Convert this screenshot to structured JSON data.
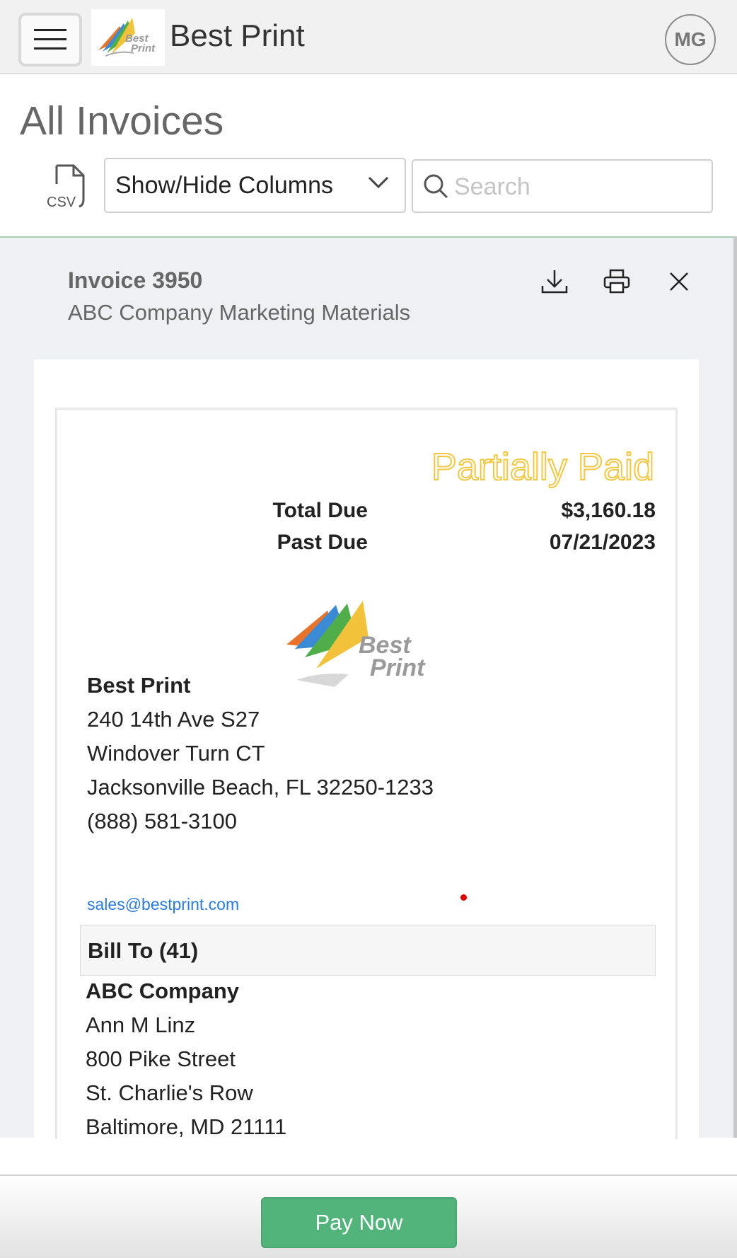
{
  "header": {
    "app_title": "Best Print",
    "avatar_initials": "MG",
    "icons": {
      "menu": "hamburger-menu-icon",
      "logo": "best-print-logo"
    }
  },
  "page": {
    "title": "All Invoices"
  },
  "toolbar": {
    "csv_label": "CSV",
    "columns_select": "Show/Hide Columns",
    "search_placeholder": "Search",
    "search_value": ""
  },
  "invoice": {
    "number": "Invoice 3950",
    "description": "ABC Company Marketing Materials",
    "actions": [
      "download-icon",
      "print-icon",
      "close-icon"
    ],
    "status": "Partially Paid",
    "status_color": "#f2c744",
    "total_due_label": "Total Due",
    "total_due_value": "$3,160.18",
    "past_due_label": "Past Due",
    "past_due_value": "07/21/2023",
    "logo_text_line1": "Best",
    "logo_text_line2": "Print"
  },
  "seller": {
    "name": "Best Print",
    "address1": "240 14th Ave S27",
    "address2": "Windover Turn CT",
    "city_state_zip": "Jacksonville Beach, FL 32250-1233",
    "phone": "(888) 581-3100",
    "email": "sales@bestprint.com"
  },
  "bill_to": {
    "heading": "Bill To (41)",
    "company": "ABC Company",
    "contact": "Ann M Linz",
    "address1": "800 Pike Street",
    "address2": "St. Charlie's Row",
    "city_state_zip": "Baltimore, MD 21111"
  },
  "footer": {
    "pay_label": "Pay Now",
    "pay_color": "#52b47a"
  }
}
